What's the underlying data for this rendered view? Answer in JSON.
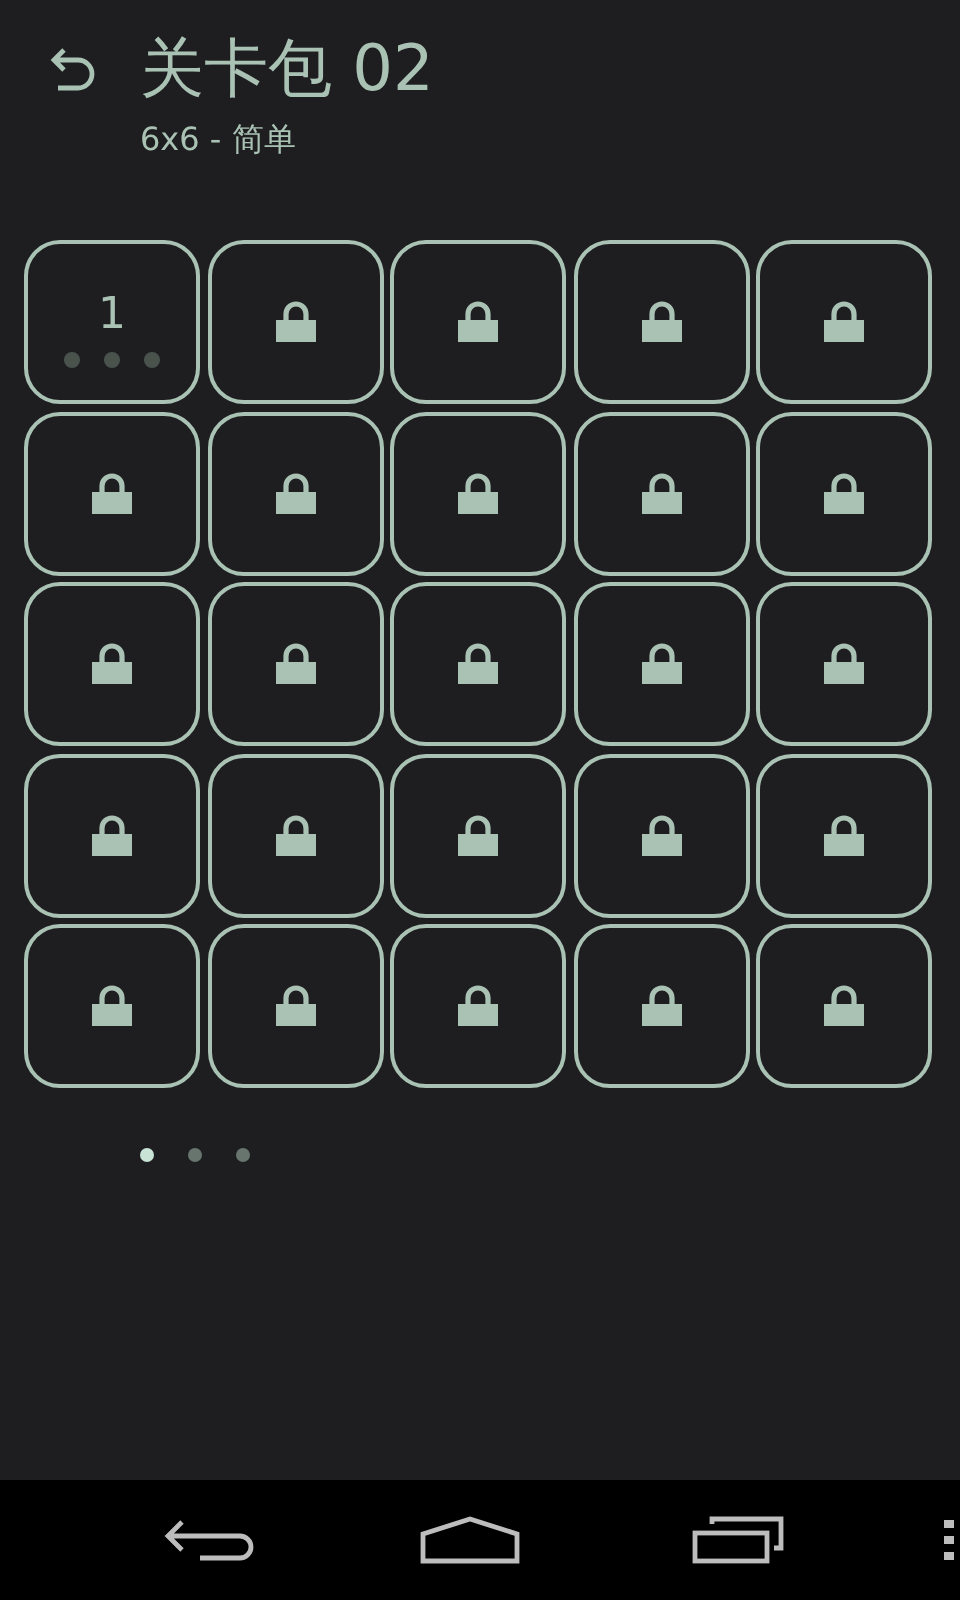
{
  "header": {
    "title": "关卡包 02",
    "subtitle": "6x6 - 简单"
  },
  "levels": [
    {
      "kind": "unlocked",
      "label": "1",
      "stars": 0
    },
    {
      "kind": "locked"
    },
    {
      "kind": "locked"
    },
    {
      "kind": "locked"
    },
    {
      "kind": "locked"
    },
    {
      "kind": "locked"
    },
    {
      "kind": "locked"
    },
    {
      "kind": "locked"
    },
    {
      "kind": "locked"
    },
    {
      "kind": "locked"
    },
    {
      "kind": "locked"
    },
    {
      "kind": "locked"
    },
    {
      "kind": "locked"
    },
    {
      "kind": "locked"
    },
    {
      "kind": "locked"
    },
    {
      "kind": "locked"
    },
    {
      "kind": "locked"
    },
    {
      "kind": "locked"
    },
    {
      "kind": "locked"
    },
    {
      "kind": "locked"
    },
    {
      "kind": "locked"
    },
    {
      "kind": "locked"
    },
    {
      "kind": "locked"
    },
    {
      "kind": "locked"
    },
    {
      "kind": "locked"
    }
  ],
  "pages": [
    {
      "selected": true
    },
    {
      "selected": false
    },
    {
      "selected": false
    }
  ]
}
